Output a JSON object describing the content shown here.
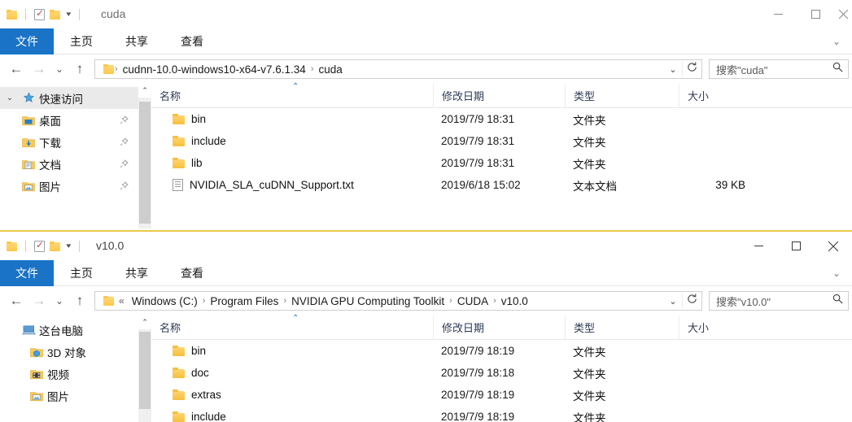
{
  "windows": [
    {
      "id": "cuda",
      "title": "cuda",
      "quick_access": {
        "folder_icon": "folder-icon",
        "properties_icon": "properties-checkmark-icon",
        "new_folder_icon": "new-folder-icon",
        "customize_caret": "▾"
      },
      "caption": {
        "minimize": "—",
        "maximize": "▢",
        "close": "✕"
      },
      "ribbon": {
        "tabs": [
          {
            "label": "文件",
            "active": true
          },
          {
            "label": "主页",
            "active": false
          },
          {
            "label": "共享",
            "active": false
          },
          {
            "label": "查看",
            "active": false
          }
        ],
        "expand_icon": "chevron-down-icon"
      },
      "nav": {
        "back": "←",
        "forward": "→",
        "recent": "⌄",
        "up": "↑"
      },
      "address": {
        "overflow": "",
        "crumbs": [
          "cudnn-10.0-windows10-x64-v7.6.1.34",
          "cuda"
        ],
        "separator": "›",
        "dropdown_icon": "chevron-down-icon",
        "refresh_icon": "refresh-icon"
      },
      "search": {
        "text": "搜索\"cuda\"",
        "icon": "search-icon"
      },
      "sidebar": [
        {
          "label": "快速访问",
          "icon": "star-pin-icon",
          "header": true,
          "chevron": "⌄",
          "pinned": false
        },
        {
          "label": "桌面",
          "icon": "desktop-folder-icon",
          "header": false,
          "pinned": true
        },
        {
          "label": "下载",
          "icon": "downloads-folder-icon",
          "header": false,
          "pinned": true
        },
        {
          "label": "文档",
          "icon": "documents-folder-icon",
          "header": false,
          "pinned": true
        },
        {
          "label": "图片",
          "icon": "pictures-folder-icon",
          "header": false,
          "pinned": true
        }
      ],
      "columns": [
        {
          "label": "名称",
          "sorted": "asc"
        },
        {
          "label": "修改日期",
          "sorted": ""
        },
        {
          "label": "类型",
          "sorted": ""
        },
        {
          "label": "大小",
          "sorted": ""
        }
      ],
      "files": [
        {
          "name": "bin",
          "date": "2019/7/9 18:31",
          "type": "文件夹",
          "size": "",
          "icon": "folder-icon"
        },
        {
          "name": "include",
          "date": "2019/7/9 18:31",
          "type": "文件夹",
          "size": "",
          "icon": "folder-icon"
        },
        {
          "name": "lib",
          "date": "2019/7/9 18:31",
          "type": "文件夹",
          "size": "",
          "icon": "folder-icon"
        },
        {
          "name": "NVIDIA_SLA_cuDNN_Support.txt",
          "date": "2019/6/18 15:02",
          "type": "文本文档",
          "size": "39 KB",
          "icon": "text-file-icon"
        }
      ]
    },
    {
      "id": "v100",
      "title": "v10.0",
      "quick_access": {
        "folder_icon": "folder-icon",
        "properties_icon": "properties-checkmark-icon",
        "new_folder_icon": "new-folder-icon",
        "customize_caret": "▾"
      },
      "caption": {
        "minimize": "—",
        "maximize": "▢",
        "close": "✕"
      },
      "ribbon": {
        "tabs": [
          {
            "label": "文件",
            "active": true
          },
          {
            "label": "主页",
            "active": false
          },
          {
            "label": "共享",
            "active": false
          },
          {
            "label": "查看",
            "active": false
          }
        ],
        "expand_icon": "chevron-down-icon"
      },
      "nav": {
        "back": "←",
        "forward": "→",
        "recent": "⌄",
        "up": "↑"
      },
      "address": {
        "overflow": "«",
        "crumbs": [
          "Windows (C:)",
          "Program Files",
          "NVIDIA GPU Computing Toolkit",
          "CUDA",
          "v10.0"
        ],
        "separator": "›",
        "dropdown_icon": "chevron-down-icon",
        "refresh_icon": "refresh-icon"
      },
      "search": {
        "text": "搜索\"v10.0\"",
        "icon": "search-icon"
      },
      "sidebar": [
        {
          "label": "这台电脑",
          "icon": "this-pc-icon",
          "header": false,
          "pinned": false
        },
        {
          "label": "3D 对象",
          "icon": "3d-objects-icon",
          "header": false,
          "pinned": false
        },
        {
          "label": "视频",
          "icon": "videos-folder-icon",
          "header": false,
          "pinned": false
        },
        {
          "label": "图片",
          "icon": "pictures-folder-icon",
          "header": false,
          "pinned": false
        }
      ],
      "columns": [
        {
          "label": "名称",
          "sorted": "asc"
        },
        {
          "label": "修改日期",
          "sorted": ""
        },
        {
          "label": "类型",
          "sorted": ""
        },
        {
          "label": "大小",
          "sorted": ""
        }
      ],
      "files": [
        {
          "name": "bin",
          "date": "2019/7/9 18:19",
          "type": "文件夹",
          "size": "",
          "icon": "folder-icon"
        },
        {
          "name": "doc",
          "date": "2019/7/9 18:18",
          "type": "文件夹",
          "size": "",
          "icon": "folder-icon"
        },
        {
          "name": "extras",
          "date": "2019/7/9 18:19",
          "type": "文件夹",
          "size": "",
          "icon": "folder-icon"
        },
        {
          "name": "include",
          "date": "2019/7/9 18:19",
          "type": "文件夹",
          "size": "",
          "icon": "folder-icon"
        }
      ]
    }
  ],
  "colors": {
    "file_tab_blue": "#1a73c6",
    "folder_yellow": "#f6bf3e",
    "active_border_gold": "#e8c84a",
    "column_header_text": "#2b3a55"
  }
}
